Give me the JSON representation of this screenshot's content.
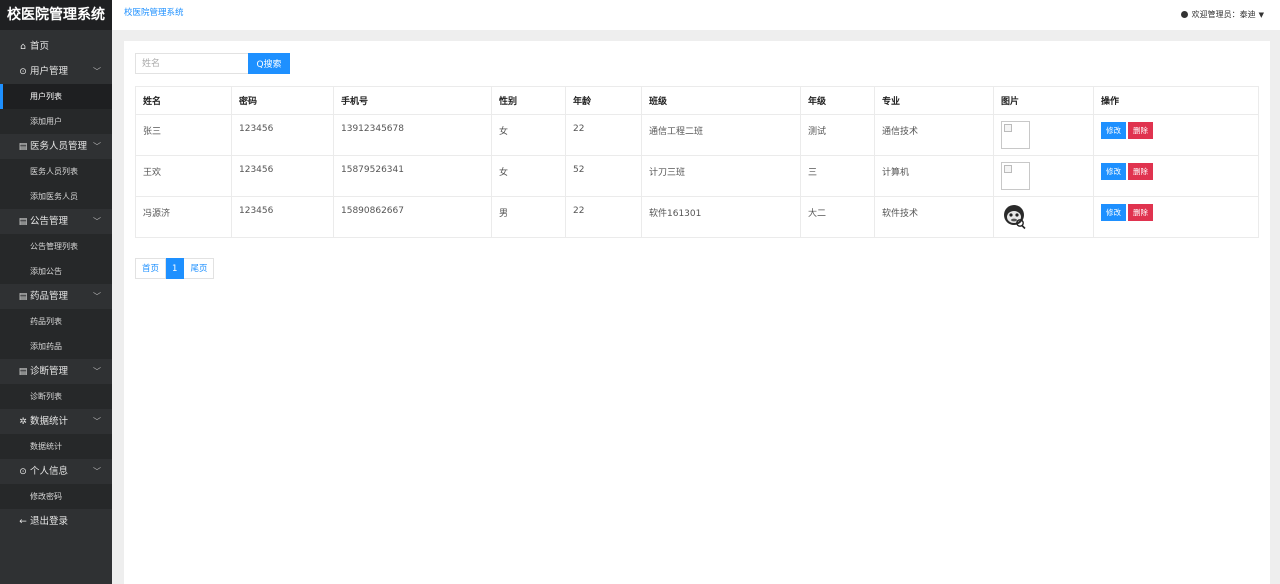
{
  "sidebar": {
    "brand": "校医院管理系统",
    "menu": [
      {
        "type": "group",
        "icon": "home-icon",
        "glyph": "⌂",
        "label": "首页",
        "chevron": false
      },
      {
        "type": "group",
        "icon": "user-icon",
        "glyph": "⊙",
        "label": "用户管理",
        "chevron": true
      },
      {
        "type": "sub",
        "label": "用户列表",
        "active": true
      },
      {
        "type": "sub",
        "label": "添加用户",
        "active": false
      },
      {
        "type": "group",
        "icon": "document-icon",
        "glyph": "▤",
        "label": "医务人员管理",
        "chevron": true
      },
      {
        "type": "sub",
        "label": "医务人员列表",
        "active": false
      },
      {
        "type": "sub",
        "label": "添加医务人员",
        "active": false
      },
      {
        "type": "group",
        "icon": "document-icon",
        "glyph": "▤",
        "label": "公告管理",
        "chevron": true
      },
      {
        "type": "sub",
        "label": "公告管理列表",
        "active": false
      },
      {
        "type": "sub",
        "label": "添加公告",
        "active": false
      },
      {
        "type": "group",
        "icon": "document-icon",
        "glyph": "▤",
        "label": "药品管理",
        "chevron": true
      },
      {
        "type": "sub",
        "label": "药品列表",
        "active": false
      },
      {
        "type": "sub",
        "label": "添加药品",
        "active": false
      },
      {
        "type": "group",
        "icon": "document-icon",
        "glyph": "▤",
        "label": "诊断管理",
        "chevron": true
      },
      {
        "type": "sub",
        "label": "诊断列表",
        "active": false
      },
      {
        "type": "group",
        "icon": "stats-icon",
        "glyph": "✲",
        "label": "数据统计",
        "chevron": true
      },
      {
        "type": "sub",
        "label": "数据统计",
        "active": false
      },
      {
        "type": "group",
        "icon": "person-icon",
        "glyph": "⊙",
        "label": "个人信息",
        "chevron": true
      },
      {
        "type": "sub",
        "label": "修改密码",
        "active": false
      },
      {
        "type": "group",
        "icon": "arrow-left-icon",
        "glyph": "←",
        "label": "退出登录",
        "chevron": false
      }
    ]
  },
  "header": {
    "breadcrumb": "校医院管理系统",
    "welcome": "欢迎管理员：泰迪"
  },
  "search": {
    "placeholder": "姓名",
    "button_label": "Q搜索"
  },
  "table": {
    "headers": [
      "姓名",
      "密码",
      "手机号",
      "性别",
      "年龄",
      "班级",
      "年级",
      "专业",
      "图片",
      "操作"
    ],
    "rows": [
      {
        "name": "张三",
        "password": "123456",
        "phone": "13912345678",
        "gender": "女",
        "age": "22",
        "class": "通信工程二班",
        "grade": "测试",
        "major": "通信技术",
        "image": "broken"
      },
      {
        "name": "王欢",
        "password": "123456",
        "phone": "15879526341",
        "gender": "女",
        "age": "52",
        "class": "计刀三班",
        "grade": "三",
        "major": "计算机",
        "image": "broken"
      },
      {
        "name": "冯源济",
        "password": "123456",
        "phone": "15890862667",
        "gender": "男",
        "age": "22",
        "class": "软件161301",
        "grade": "大二",
        "major": "软件技术",
        "image": "monkey"
      }
    ],
    "edit_label": "修改",
    "delete_label": "删除"
  },
  "pagination": {
    "first": "首页",
    "current": "1",
    "last": "尾页"
  },
  "colors": {
    "primary": "#1e90ff",
    "danger": "#e0334f",
    "sidebar_bg": "#2f3133"
  }
}
